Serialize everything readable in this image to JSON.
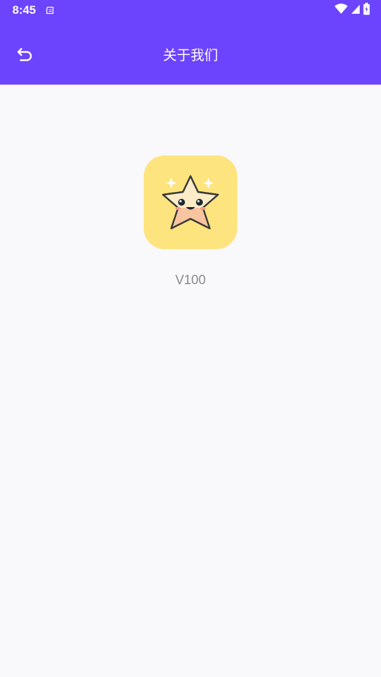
{
  "status_bar": {
    "time": "8:45",
    "icons": [
      "notification-icon",
      "wifi-icon",
      "cellular-signal-icon",
      "battery-icon"
    ]
  },
  "app_bar": {
    "title": "关于我们",
    "back_icon": "back-arrow-icon",
    "background_color": "#6d44fd"
  },
  "content": {
    "app_icon": "star-mascot-logo",
    "icon_background": "#fee47e",
    "version": "V100"
  }
}
